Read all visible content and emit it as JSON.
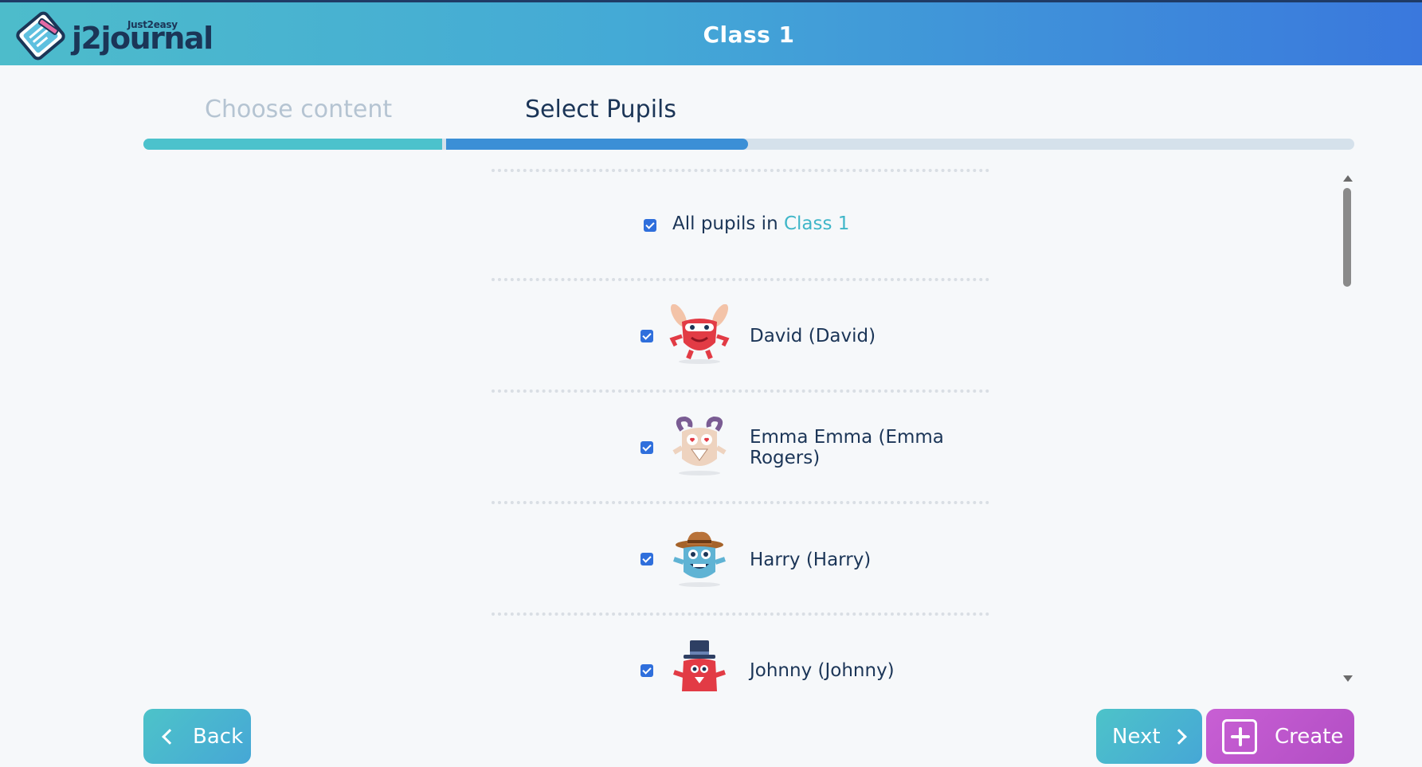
{
  "header": {
    "logo_small": "Just2easy",
    "logo_text": "j2journal",
    "title": "Class 1"
  },
  "steps": [
    {
      "label": "Choose content",
      "state": "completed"
    },
    {
      "label": "Select Pupils",
      "state": "current"
    }
  ],
  "progress": {
    "completed_steps": 2,
    "total_steps": 4
  },
  "all_pupils": {
    "checked": true,
    "label_prefix": "All pupils in",
    "class_name": "Class 1"
  },
  "pupils": [
    {
      "name": "David (David)",
      "checked": true,
      "avatar": "red-bunny-monster-icon"
    },
    {
      "name": "Emma Emma (Emma Rogers)",
      "checked": true,
      "avatar": "horned-beige-monster-icon"
    },
    {
      "name": "Harry (Harry)",
      "checked": true,
      "avatar": "blue-cowboy-monster-icon"
    },
    {
      "name": "Johnny (Johnny)",
      "checked": true,
      "avatar": "red-top-hat-monster-icon"
    }
  ],
  "buttons": {
    "back": "Back",
    "next": "Next",
    "create": "Create"
  },
  "colors": {
    "header_gradient_start": "#4dbccb",
    "header_gradient_end": "#3a78dd",
    "accent_teal": "#4cc2cc",
    "accent_blue": "#3b8fd6",
    "create_purple": "#c85fd4",
    "text_dark": "#1b3557"
  }
}
